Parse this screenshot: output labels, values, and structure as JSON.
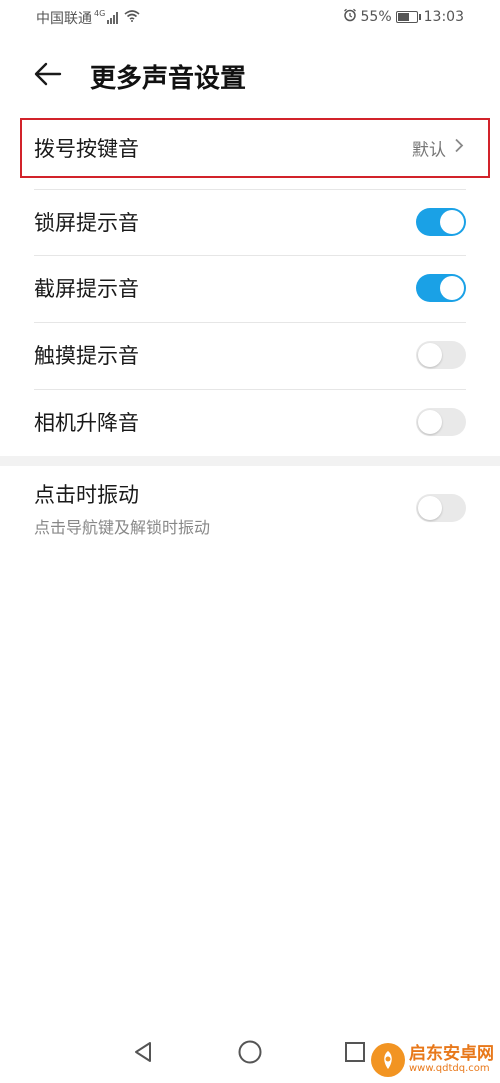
{
  "status_bar": {
    "carrier": "中国联通",
    "network": "4G",
    "battery": "55%",
    "battery_level": 0.55,
    "time": "13:03"
  },
  "header": {
    "title": "更多声音设置"
  },
  "settings": {
    "dial_tone": {
      "label": "拨号按键音",
      "value": "默认"
    },
    "lock_sound": {
      "label": "锁屏提示音",
      "enabled": true
    },
    "screenshot_sound": {
      "label": "截屏提示音",
      "enabled": true
    },
    "touch_sound": {
      "label": "触摸提示音",
      "enabled": false
    },
    "camera_lift_sound": {
      "label": "相机升降音",
      "enabled": false
    },
    "vibrate_on_tap": {
      "label": "点击时振动",
      "description": "点击导航键及解锁时振动",
      "enabled": false
    }
  },
  "colors": {
    "accent": "#1aa1e6",
    "highlight": "#d2232a"
  },
  "watermark": {
    "title": "启东安卓网",
    "url": "www.qdtdq.com"
  }
}
